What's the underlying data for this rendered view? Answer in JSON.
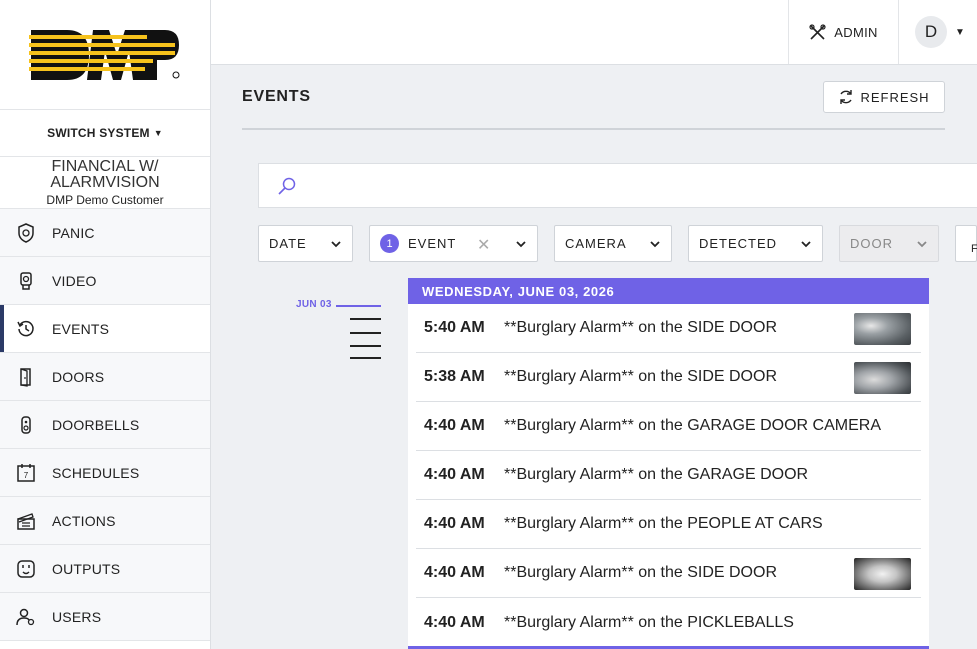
{
  "brand": {
    "logo_text": "DMP"
  },
  "sidebar": {
    "switch_system_label": "SWITCH SYSTEM",
    "system_name": "FINANCIAL W/ ALARMVISION",
    "customer_name": "DMP Demo Customer",
    "items": [
      {
        "label": "PANIC",
        "icon": "panic-shield-icon"
      },
      {
        "label": "VIDEO",
        "icon": "video-camera-icon"
      },
      {
        "label": "EVENTS",
        "icon": "events-history-icon",
        "active": true
      },
      {
        "label": "DOORS",
        "icon": "door-icon"
      },
      {
        "label": "DOORBELLS",
        "icon": "doorbell-icon"
      },
      {
        "label": "SCHEDULES",
        "icon": "calendar-icon"
      },
      {
        "label": "ACTIONS",
        "icon": "clapperboard-icon"
      },
      {
        "label": "OUTPUTS",
        "icon": "outlet-icon"
      },
      {
        "label": "USERS",
        "icon": "users-icon"
      }
    ]
  },
  "topbar": {
    "admin_label": "ADMIN",
    "avatar_initial": "D"
  },
  "main": {
    "title": "EVENTS",
    "refresh_label": "REFRESH",
    "search_placeholder": "",
    "filters": [
      {
        "label": "DATE"
      },
      {
        "label": "EVENT",
        "badge": "1"
      },
      {
        "label": "CAMERA"
      },
      {
        "label": "DETECTED"
      },
      {
        "label": "DOOR",
        "disabled": true
      },
      {
        "label": "F"
      }
    ]
  },
  "timeline": {
    "date_marker": "JUN 03"
  },
  "events": {
    "day_header": "WEDNESDAY, JUNE 03, 2026",
    "rows": [
      {
        "time": "5:40 AM",
        "description": "**Burglary Alarm** on the SIDE DOOR",
        "has_thumbnail": true
      },
      {
        "time": "5:38 AM",
        "description": "**Burglary Alarm** on the SIDE DOOR",
        "has_thumbnail": true
      },
      {
        "time": "4:40 AM",
        "description": "**Burglary Alarm** on the GARAGE DOOR CAMERA",
        "has_thumbnail": false
      },
      {
        "time": "4:40 AM",
        "description": "**Burglary Alarm** on the GARAGE DOOR",
        "has_thumbnail": false
      },
      {
        "time": "4:40 AM",
        "description": "**Burglary Alarm** on the PEOPLE AT CARS",
        "has_thumbnail": false
      },
      {
        "time": "4:40 AM",
        "description": "**Burglary Alarm** on the SIDE DOOR",
        "has_thumbnail": true
      },
      {
        "time": "4:40 AM",
        "description": "**Burglary Alarm** on the PICKLEBALLS",
        "has_thumbnail": false
      }
    ]
  },
  "colors": {
    "accent": "#6f62e6",
    "logo_yellow": "#f6c21c",
    "logo_dark": "#111111",
    "active_nav_bar": "#2b3a67"
  }
}
